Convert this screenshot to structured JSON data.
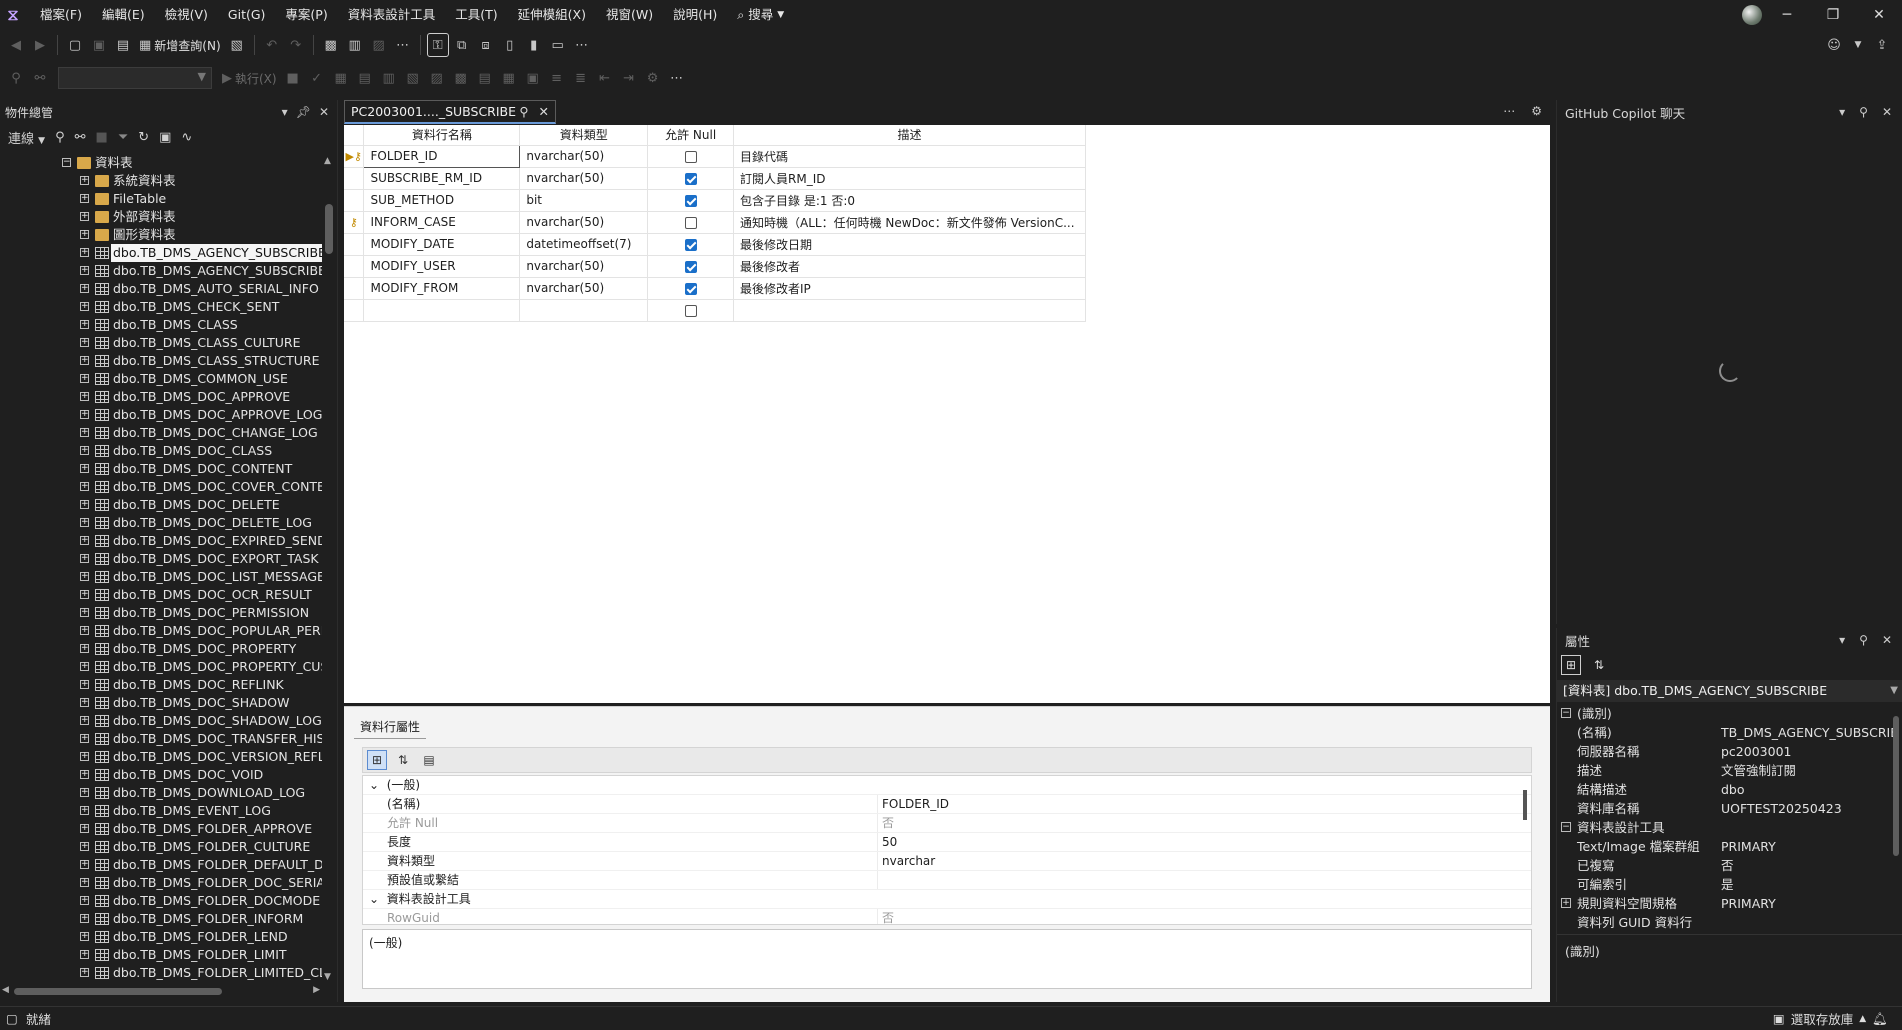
{
  "menu": {
    "items": [
      "檔案(F)",
      "編輯(E)",
      "檢視(V)",
      "Git(G)",
      "專案(P)",
      "資料表設計工具",
      "工具(T)",
      "延伸模組(X)",
      "視窗(W)",
      "說明(H)"
    ],
    "search_label": "搜尋"
  },
  "toolbar": {
    "new_query_label": "新增查詢(N)",
    "execute_label": "執行(X)"
  },
  "object_explorer": {
    "title": "物件總管",
    "connect_label": "連線",
    "tree": {
      "tables_folder": "資料表",
      "folders": [
        "系統資料表",
        "FileTable",
        "外部資料表",
        "圖形資料表"
      ],
      "tables": [
        "dbo.TB_DMS_AGENCY_SUBSCRIBE",
        "dbo.TB_DMS_AGENCY_SUBSCRIBE_l",
        "dbo.TB_DMS_AUTO_SERIAL_INFO",
        "dbo.TB_DMS_CHECK_SENT",
        "dbo.TB_DMS_CLASS",
        "dbo.TB_DMS_CLASS_CULTURE",
        "dbo.TB_DMS_CLASS_STRUCTURE",
        "dbo.TB_DMS_COMMON_USE",
        "dbo.TB_DMS_DOC_APPROVE",
        "dbo.TB_DMS_DOC_APPROVE_LOG",
        "dbo.TB_DMS_DOC_CHANGE_LOG",
        "dbo.TB_DMS_DOC_CLASS",
        "dbo.TB_DMS_DOC_CONTENT",
        "dbo.TB_DMS_DOC_COVER_CONTEN",
        "dbo.TB_DMS_DOC_DELETE",
        "dbo.TB_DMS_DOC_DELETE_LOG",
        "dbo.TB_DMS_DOC_EXPIRED_SENDR",
        "dbo.TB_DMS_DOC_EXPORT_TASK",
        "dbo.TB_DMS_DOC_LIST_MESSAGE",
        "dbo.TB_DMS_DOC_OCR_RESULT",
        "dbo.TB_DMS_DOC_PERMISSION",
        "dbo.TB_DMS_DOC_POPULAR_PERM",
        "dbo.TB_DMS_DOC_PROPERTY",
        "dbo.TB_DMS_DOC_PROPERTY_CUST",
        "dbo.TB_DMS_DOC_REFLINK",
        "dbo.TB_DMS_DOC_SHADOW",
        "dbo.TB_DMS_DOC_SHADOW_LOG",
        "dbo.TB_DMS_DOC_TRANSFER_HIST",
        "dbo.TB_DMS_DOC_VERSION_REFLIN",
        "dbo.TB_DMS_DOC_VOID",
        "dbo.TB_DMS_DOWNLOAD_LOG",
        "dbo.TB_DMS_EVENT_LOG",
        "dbo.TB_DMS_FOLDER_APPROVE",
        "dbo.TB_DMS_FOLDER_CULTURE",
        "dbo.TB_DMS_FOLDER_DEFAULT_DC",
        "dbo.TB_DMS_FOLDER_DOC_SERIAL",
        "dbo.TB_DMS_FOLDER_DOCMODE",
        "dbo.TB_DMS_FOLDER_INFORM",
        "dbo.TB_DMS_FOLDER_LEND",
        "dbo.TB_DMS_FOLDER_LIMIT",
        "dbo.TB_DMS_FOLDER_LIMITED_CLA"
      ]
    }
  },
  "document": {
    "tab_title": "PC2003001...._SUBSCRIBE",
    "columns_header": [
      "資料行名稱",
      "資料類型",
      "允許 Null",
      "描述"
    ],
    "rows": [
      {
        "name": "FOLDER_ID",
        "type": "nvarchar(50)",
        "nullable": false,
        "desc": "目錄代碼",
        "key": true
      },
      {
        "name": "SUBSCRIBE_RM_ID",
        "type": "nvarchar(50)",
        "nullable": true,
        "desc": "訂閱人員RM_ID",
        "key": false
      },
      {
        "name": "SUB_METHOD",
        "type": "bit",
        "nullable": true,
        "desc": "包含子目錄 是:1 否:0",
        "key": false
      },
      {
        "name": "INFORM_CASE",
        "type": "nvarchar(50)",
        "nullable": false,
        "desc": "通知時機（ALL：任何時機 NewDoc：新文件發佈 VersionC...",
        "key": true
      },
      {
        "name": "MODIFY_DATE",
        "type": "datetimeoffset(7)",
        "nullable": true,
        "desc": "最後修改日期",
        "key": false
      },
      {
        "name": "MODIFY_USER",
        "type": "nvarchar(50)",
        "nullable": true,
        "desc": "最後修改者",
        "key": false
      },
      {
        "name": "MODIFY_FROM",
        "type": "nvarchar(50)",
        "nullable": true,
        "desc": "最後修改者IP",
        "key": false
      }
    ]
  },
  "column_properties": {
    "tab_label": "資料行屬性",
    "general_category": "(一般)",
    "general_rows": [
      {
        "key": "(名稱)",
        "value": "FOLDER_ID",
        "dim": false
      },
      {
        "key": "允許 Null",
        "value": "否",
        "dim": true
      },
      {
        "key": "長度",
        "value": "50",
        "dim": false
      },
      {
        "key": "資料類型",
        "value": "nvarchar",
        "dim": false
      },
      {
        "key": "預設值或繫結",
        "value": "",
        "dim": false
      }
    ],
    "designer_category": "資料表設計工具",
    "designer_rows": [
      {
        "key": "RowGuid",
        "value": "否",
        "dim": true
      }
    ],
    "description": "(一般)"
  },
  "copilot": {
    "title": "GitHub Copilot 聊天"
  },
  "properties": {
    "title": "屬性",
    "object": "[資料表] dbo.TB_DMS_AGENCY_SUBSCRIBE",
    "identity_category": "(識別)",
    "identity_rows": [
      {
        "key": "(名稱)",
        "value": "TB_DMS_AGENCY_SUBSCRIE"
      },
      {
        "key": "伺服器名稱",
        "value": "pc2003001"
      },
      {
        "key": "描述",
        "value": "文管強制訂閱"
      },
      {
        "key": "結構描述",
        "value": "dbo"
      },
      {
        "key": "資料庫名稱",
        "value": "UOFTEST20250423"
      }
    ],
    "designer_category": "資料表設計工具",
    "designer_rows": [
      {
        "key": "Text/Image 檔案群組",
        "value": "PRIMARY"
      },
      {
        "key": "已複寫",
        "value": "否"
      },
      {
        "key": "可編索引",
        "value": "是"
      }
    ],
    "space_category": "規則資料空間規格",
    "space_value": "PRIMARY",
    "guid_row": {
      "key": "資料列 GUID 資料行",
      "value": ""
    },
    "description": "(識別)"
  },
  "status": {
    "ready": "就緒",
    "fault_label": "選取存放庫"
  },
  "colors": {
    "accent": "#1a6fc9",
    "background": "#1f1f1f",
    "key_icon": "#c28a00"
  }
}
